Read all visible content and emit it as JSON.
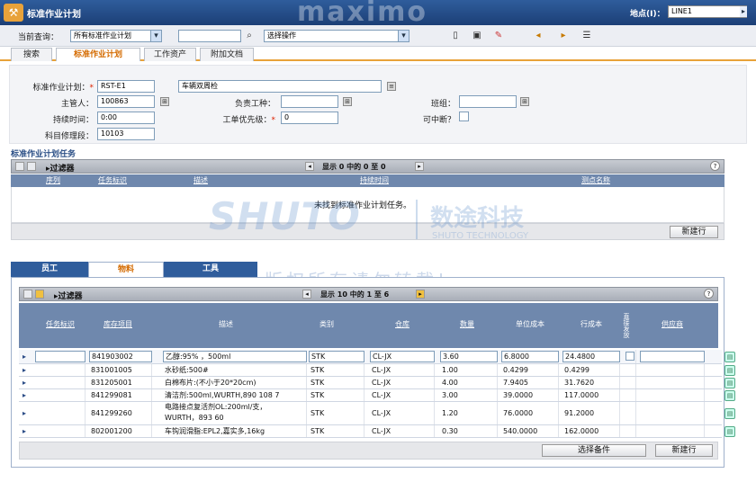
{
  "app": {
    "title": "标准作业计划",
    "brand": "maximo",
    "site_label": "地点(I)：",
    "site_value": "LINE1"
  },
  "toolbar": {
    "query_label": "当前查询：",
    "query_value": "所有标准作业计划",
    "search_value": "",
    "action_label": "选择操作"
  },
  "tabs": [
    "搜索",
    "标准作业计划",
    "工作资产",
    "附加文档"
  ],
  "form": {
    "plan_label": "标准作业计划：",
    "plan_value": "RST-E1",
    "plan_desc": "车辆双周检",
    "supervisor_label": "主管人：",
    "supervisor_value": "100863",
    "duration_label": "持续时间：",
    "duration_value": "0:00",
    "gl_label": "科目修理段：",
    "gl_value": "10103",
    "owner_label": "负责工种：",
    "owner_value": "",
    "priority_label": "工单优先级：",
    "priority_value": "0",
    "crew_label": "班组：",
    "crew_value": "",
    "interrupt_label": "可中断？"
  },
  "tasks": {
    "section_title": "标准作业计划任务",
    "filter_label": "▸过滤器",
    "paging": "显示 0 中的 0 至 0",
    "columns": [
      "序列",
      "任务标识",
      "描述",
      "持续时间",
      "测点名称"
    ],
    "empty_message": "未找到标准作业计划任务。",
    "new_row": "新建行"
  },
  "watermark": {
    "brand": "SHUTO",
    "cn": "数途科技",
    "en": "SHUTO TECHNOLOGY",
    "copyright": "版权所有请勿转载!"
  },
  "lower_tabs": [
    "员工",
    "物料",
    "工具"
  ],
  "materials": {
    "filter_label": "▸过滤器",
    "paging": "显示 10 中的 1 至 6",
    "columns": [
      "任务标识",
      "库存项目",
      "描述",
      "类别",
      "仓库",
      "数量",
      "单位成本",
      "行成本",
      "直接发放",
      "供应商"
    ],
    "rows": [
      {
        "item": "841903002",
        "desc": "乙醇:95% ，500ml",
        "category": "STK",
        "store": "CL-JX",
        "qty": "3.60",
        "unit_cost": "6.8000",
        "line_cost": "24.4800"
      },
      {
        "item": "831001005",
        "desc": "水砂纸:500#",
        "category": "STK",
        "store": "CL-JX",
        "qty": "1.00",
        "unit_cost": "0.4299",
        "line_cost": "0.4299"
      },
      {
        "item": "831205001",
        "desc": "白棉布片:(不小于20*20cm)",
        "category": "STK",
        "store": "CL-JX",
        "qty": "4.00",
        "unit_cost": "7.9405",
        "line_cost": "31.7620"
      },
      {
        "item": "841299081",
        "desc": "清洁剂:500ml,WURTH,890 108 7",
        "category": "STK",
        "store": "CL-JX",
        "qty": "3.00",
        "unit_cost": "39.0000",
        "line_cost": "117.0000"
      },
      {
        "item": "841299260",
        "desc": "电路接点复活剂OL:200ml/支，",
        "desc2": "WURTH，893 60",
        "category": "STK",
        "store": "CL-JX",
        "qty": "1.20",
        "unit_cost": "76.0000",
        "line_cost": "91.2000"
      },
      {
        "item": "802001200",
        "desc": "车钩润滑脂:EPL2,嘉实多,16kg",
        "category": "STK",
        "store": "CL-JX",
        "qty": "0.30",
        "unit_cost": "540.0000",
        "line_cost": "162.0000"
      }
    ],
    "select_spare": "选择备件",
    "new_row": "新建行"
  }
}
